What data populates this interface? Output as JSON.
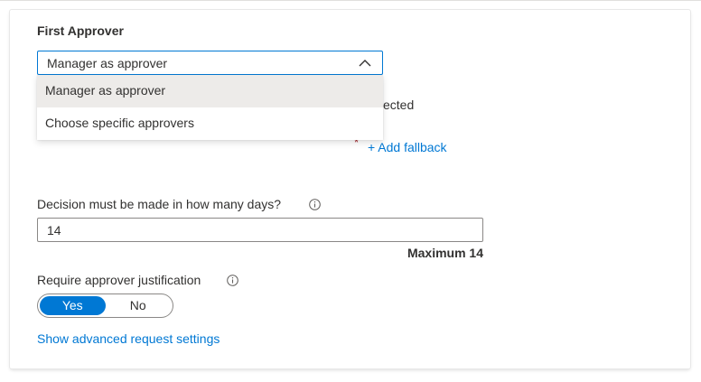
{
  "first_approver": {
    "title": "First Approver",
    "dropdown": {
      "selected": "Manager as approver",
      "options": [
        "Manager as approver",
        "Choose specific approvers"
      ]
    },
    "obscured_text": "ected",
    "add_fallback": "+ Add fallback"
  },
  "decision": {
    "label": "Decision must be made in how many days?",
    "value": "14",
    "maximum": "Maximum 14"
  },
  "justification": {
    "label": "Require approver justification",
    "yes": "Yes",
    "no": "No",
    "selected": "Yes"
  },
  "advanced_link": "Show advanced request settings",
  "colors": {
    "accent": "#0078d4",
    "required": "#a4262c",
    "text": "#323130"
  }
}
